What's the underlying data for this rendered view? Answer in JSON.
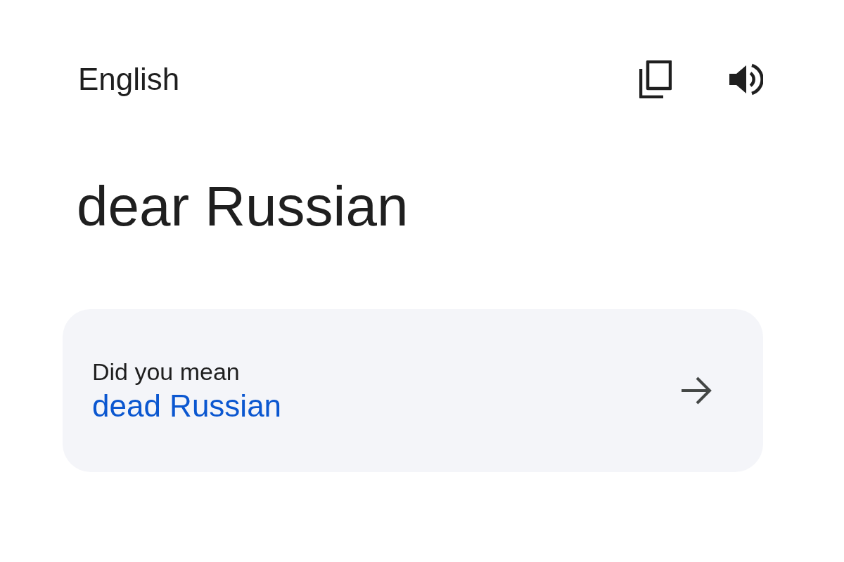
{
  "language": "English",
  "source_text": "dear Russian",
  "suggestion": {
    "label": "Did you mean",
    "text": "dead Russian"
  }
}
